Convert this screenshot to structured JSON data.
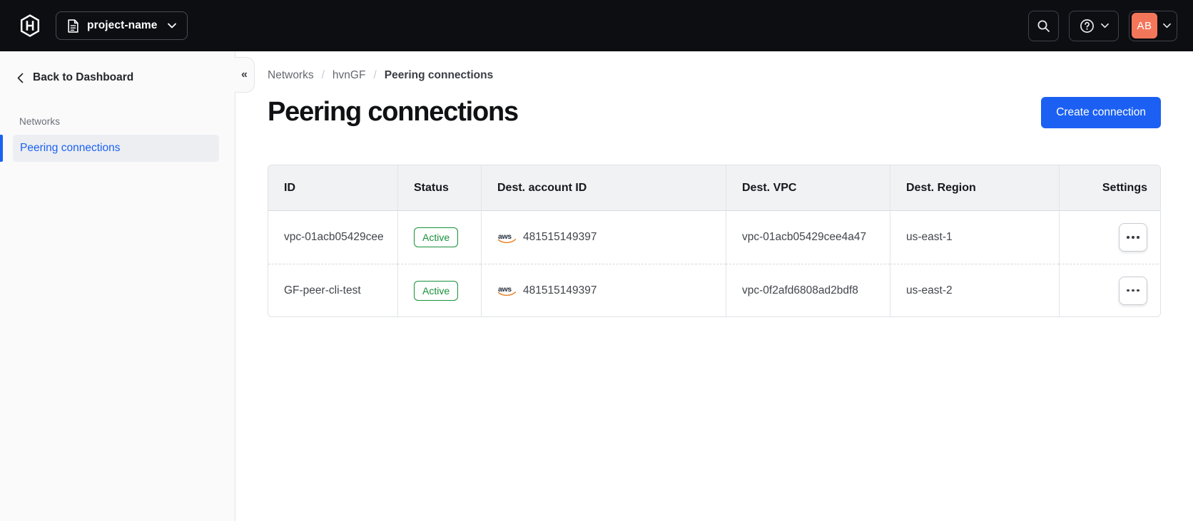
{
  "nav": {
    "project_switcher": {
      "label": "project-name"
    },
    "user": {
      "initials": "AB"
    }
  },
  "sidebar": {
    "back_label": "Back to Dashboard",
    "section_label": "Networks",
    "active_item": "Peering connections",
    "collapse_glyph": "«"
  },
  "breadcrumb": {
    "items": [
      "Networks",
      "hvnGF",
      "Peering connections"
    ]
  },
  "page": {
    "title": "Peering connections",
    "create_button": "Create connection"
  },
  "table": {
    "columns": [
      "ID",
      "Status",
      "Dest. account ID",
      "Dest. VPC",
      "Dest. Region",
      "Settings"
    ],
    "rows": [
      {
        "id": "vpc-01acb05429cee",
        "status": "Active",
        "provider": "aws",
        "dest_account_id": "481515149397",
        "dest_vpc": "vpc-01acb05429cee4a47",
        "dest_region": "us-east-1"
      },
      {
        "id": "GF-peer-cli-test",
        "status": "Active",
        "provider": "aws",
        "dest_account_id": "481515149397",
        "dest_vpc": "vpc-0f2afd6808ad2bdf8",
        "dest_region": "us-east-2"
      }
    ]
  },
  "colors": {
    "nav_bg": "#0d0e12",
    "primary_blue": "#1b60f2",
    "active_link_blue": "#1c61f2",
    "success_green": "#169139",
    "avatar_orange": "#f4765a",
    "aws_smile_orange": "#e8862d"
  }
}
